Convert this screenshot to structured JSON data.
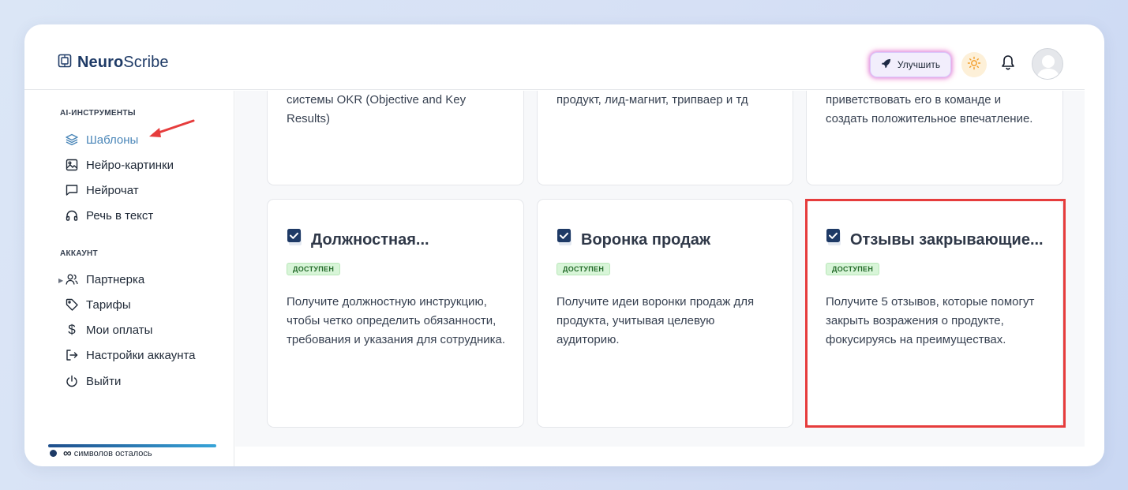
{
  "brand": {
    "name_bold": "Neuro",
    "name_regular": "Scribe"
  },
  "header": {
    "upgrade_label": "Улучшить"
  },
  "sidebar": {
    "ai_section_title": "AI-ИНСТРУМЕНТЫ",
    "ai_items": [
      {
        "label": "Шаблоны",
        "icon": "layers-icon",
        "active": true
      },
      {
        "label": "Нейро-картинки",
        "icon": "image-icon"
      },
      {
        "label": "Нейрочат",
        "icon": "chat-icon"
      },
      {
        "label": "Речь в текст",
        "icon": "headphones-icon"
      }
    ],
    "account_section_title": "АККАУНТ",
    "account_items": [
      {
        "label": "Партнерка",
        "icon": "users-icon"
      },
      {
        "label": "Тарифы",
        "icon": "tag-icon"
      },
      {
        "label": "Мои оплаты",
        "icon": "dollar-icon"
      },
      {
        "label": "Настройки аккаунта",
        "icon": "logout-arrow-icon"
      },
      {
        "label": "Выйти",
        "icon": "power-icon"
      }
    ],
    "credits_symbol": "∞",
    "credits_label": "символов осталось"
  },
  "cards_top": [
    {
      "desc": "системы OKR (Objective and Key Results)"
    },
    {
      "desc": "продукт, лид-магнит, трипваер и тд"
    },
    {
      "desc": "приветствовать его в команде и создать положительное впечатление."
    }
  ],
  "cards": [
    {
      "title": "Должностная...",
      "badge": "ДОСТУПЕН",
      "desc": "Получите должностную инструкцию, чтобы четко определить обязанности, требования и указания для сотрудника."
    },
    {
      "title": "Воронка продаж",
      "badge": "ДОСТУПЕН",
      "desc": "Получите идеи воронки продаж для продукта, учитывая целевую аудиторию."
    },
    {
      "title": "Отзывы закрывающие...",
      "badge": "ДОСТУПЕН",
      "desc": "Получите 5 отзывов, которые помогут закрыть возражения о продукте, фокусируясь на преимуществах."
    }
  ],
  "colors": {
    "accent": "#4a86b8",
    "brand": "#1e3a66",
    "highlight": "#e63c3c",
    "badge_bg": "#d8f5d8"
  }
}
